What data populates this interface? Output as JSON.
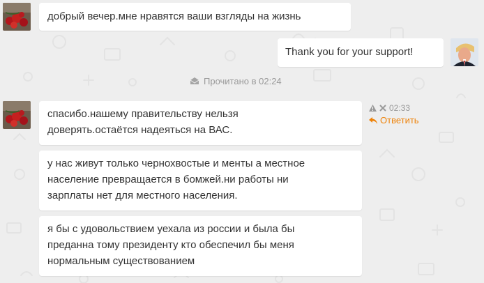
{
  "messages": [
    {
      "id": "m1",
      "direction": "incoming",
      "lines": [
        "добрый вечер.мне нравятся ваши взгляды на жизнь"
      ]
    },
    {
      "id": "m2",
      "direction": "outgoing",
      "lines": [
        "Thank you for your support!"
      ]
    },
    {
      "id": "m3",
      "direction": "incoming",
      "lines": [
        "спасибо.нашему правительству нельзя",
        "доверять.остаётся надеяться на ВАС."
      ]
    },
    {
      "id": "m4",
      "direction": "incoming",
      "lines": [
        "у нас живут только чернохвостые и менты а местное",
        "население превращается в бомжей.ни работы ни",
        "зарплаты нет для местного населения."
      ]
    },
    {
      "id": "m5",
      "direction": "incoming",
      "lines": [
        "я бы с удовольствием уехала из россии и была бы",
        "преданна тому президенту кто обеспечил бы меня",
        "нормальным существованием"
      ]
    }
  ],
  "read_status": {
    "text": "Прочитано в 02:24",
    "icon": "envelope-open-icon"
  },
  "message_meta": {
    "time": "02:33",
    "reply_label": "Ответить",
    "icons": [
      "warning-icon",
      "delete-icon",
      "reply-arrow-icon"
    ]
  },
  "colors": {
    "background": "#eeeeee",
    "bubble": "#ffffff",
    "text": "#333333",
    "muted": "#999999",
    "accent": "#ee8208"
  }
}
